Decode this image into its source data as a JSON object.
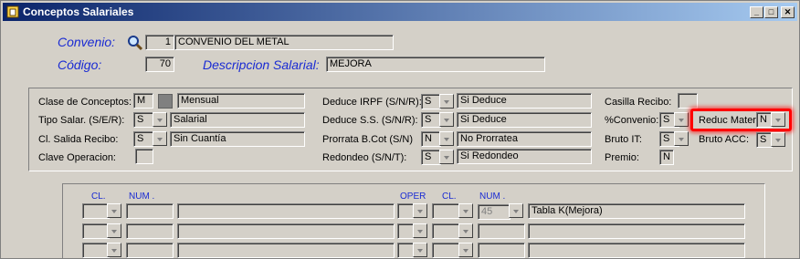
{
  "window": {
    "title": "Conceptos Salariales",
    "minimize": "_",
    "maximize": "□",
    "close": "✕"
  },
  "header": {
    "convenio_label": "Convenio:",
    "convenio_code": "1",
    "convenio_name": "CONVENIO DEL METAL",
    "codigo_label": "Código:",
    "codigo_value": "70",
    "descripcion_label": "Descripcion Salarial:",
    "descripcion_value": "MEJORA"
  },
  "fields": {
    "clase_label": "Clase de Conceptos:",
    "clase_code": "M",
    "clase_value": "Mensual",
    "tipo_label": "Tipo Salar. (S/E/R):",
    "tipo_code": "S",
    "tipo_value": "Salarial",
    "salida_label": "Cl. Salida Recibo:",
    "salida_code": "S",
    "salida_value": "Sin Cuantía",
    "clave_label": "Clave Operacion:",
    "irpf_label": "Deduce IRPF (S/N/R):",
    "irpf_code": "S",
    "irpf_value": "Si Deduce",
    "ss_label": "Deduce S.S. (S/N/R):",
    "ss_code": "S",
    "ss_value": "Si Deduce",
    "prorrata_label": "Prorrata B.Cot (S/N)",
    "prorrata_code": "N",
    "prorrata_value": "No Prorratea",
    "redondeo_label": "Redondeo (S/N/T):",
    "redondeo_code": "S",
    "redondeo_value": "Si Redondeo",
    "casilla_label": "Casilla Recibo:",
    "convenio_pct_label": "%Convenio:",
    "convenio_pct_code": "S",
    "reduc_label": "Reduc Mater",
    "reduc_code": "N",
    "bruto_it_label": "Bruto IT:",
    "bruto_it_code": "S",
    "bruto_acc_label": "Bruto ACC:",
    "bruto_acc_code": "S",
    "premio_label": "Premio:",
    "premio_code": "N"
  },
  "grid": {
    "headers": {
      "cl1": "CL.",
      "num1": "NUM .",
      "oper": "OPER",
      "cl2": "CL.",
      "num2": "NUM ."
    },
    "rows": [
      {
        "num2": "45",
        "text": "Tabla K(Mejora)"
      },
      {
        "num2": "",
        "text": ""
      },
      {
        "num2": "",
        "text": ""
      }
    ]
  },
  "colors": {
    "accent_blue": "#1a2bd3",
    "highlight": "#ff0000",
    "titlebar": "#0a246a"
  },
  "icons": {
    "window": "app-icon",
    "lookup": "magnifier-icon"
  }
}
